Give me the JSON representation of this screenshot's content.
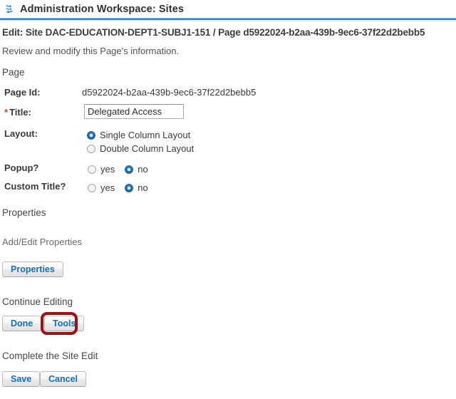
{
  "titlebar": {
    "icon": "swap-arrows-icon",
    "title": "Administration Workspace: Sites",
    "accent_color": "#1588d6"
  },
  "header": {
    "heading": "Edit: Site DAC-EDUCATION-DEPT1-SUBJ1-151 / Page d5922024-b2aa-439b-9ec6-37f22d2bebb5",
    "subtext": "Review and modify this Page's information."
  },
  "sections": {
    "page": "Page",
    "properties": "Properties",
    "continue_editing": "Continue Editing",
    "complete": "Complete the Site Edit"
  },
  "form": {
    "page_id": {
      "label": "Page Id:",
      "value": "d5922024-b2aa-439b-9ec6-37f22d2bebb5"
    },
    "title": {
      "required_marker": "*",
      "label": "Title:",
      "value": "Delegated Access",
      "placeholder": ""
    },
    "layout": {
      "label": "Layout:",
      "options": [
        {
          "label": "Single Column Layout",
          "checked": true
        },
        {
          "label": "Double Column Layout",
          "checked": false
        }
      ]
    },
    "popup": {
      "label": "Popup?",
      "options": [
        {
          "label": "yes",
          "checked": false
        },
        {
          "label": "no",
          "checked": true
        }
      ]
    },
    "custom_title": {
      "label": "Custom Title?",
      "options": [
        {
          "label": "yes",
          "checked": false
        },
        {
          "label": "no",
          "checked": true
        }
      ]
    }
  },
  "properties_section": {
    "add_edit_text": "Add/Edit Properties",
    "button_label": "Properties"
  },
  "continue_buttons": {
    "done": "Done",
    "tools": "Tools"
  },
  "complete_buttons": {
    "save": "Save",
    "cancel": "Cancel"
  },
  "annotation": {
    "target": "tools-button",
    "color": "#9d1111"
  }
}
